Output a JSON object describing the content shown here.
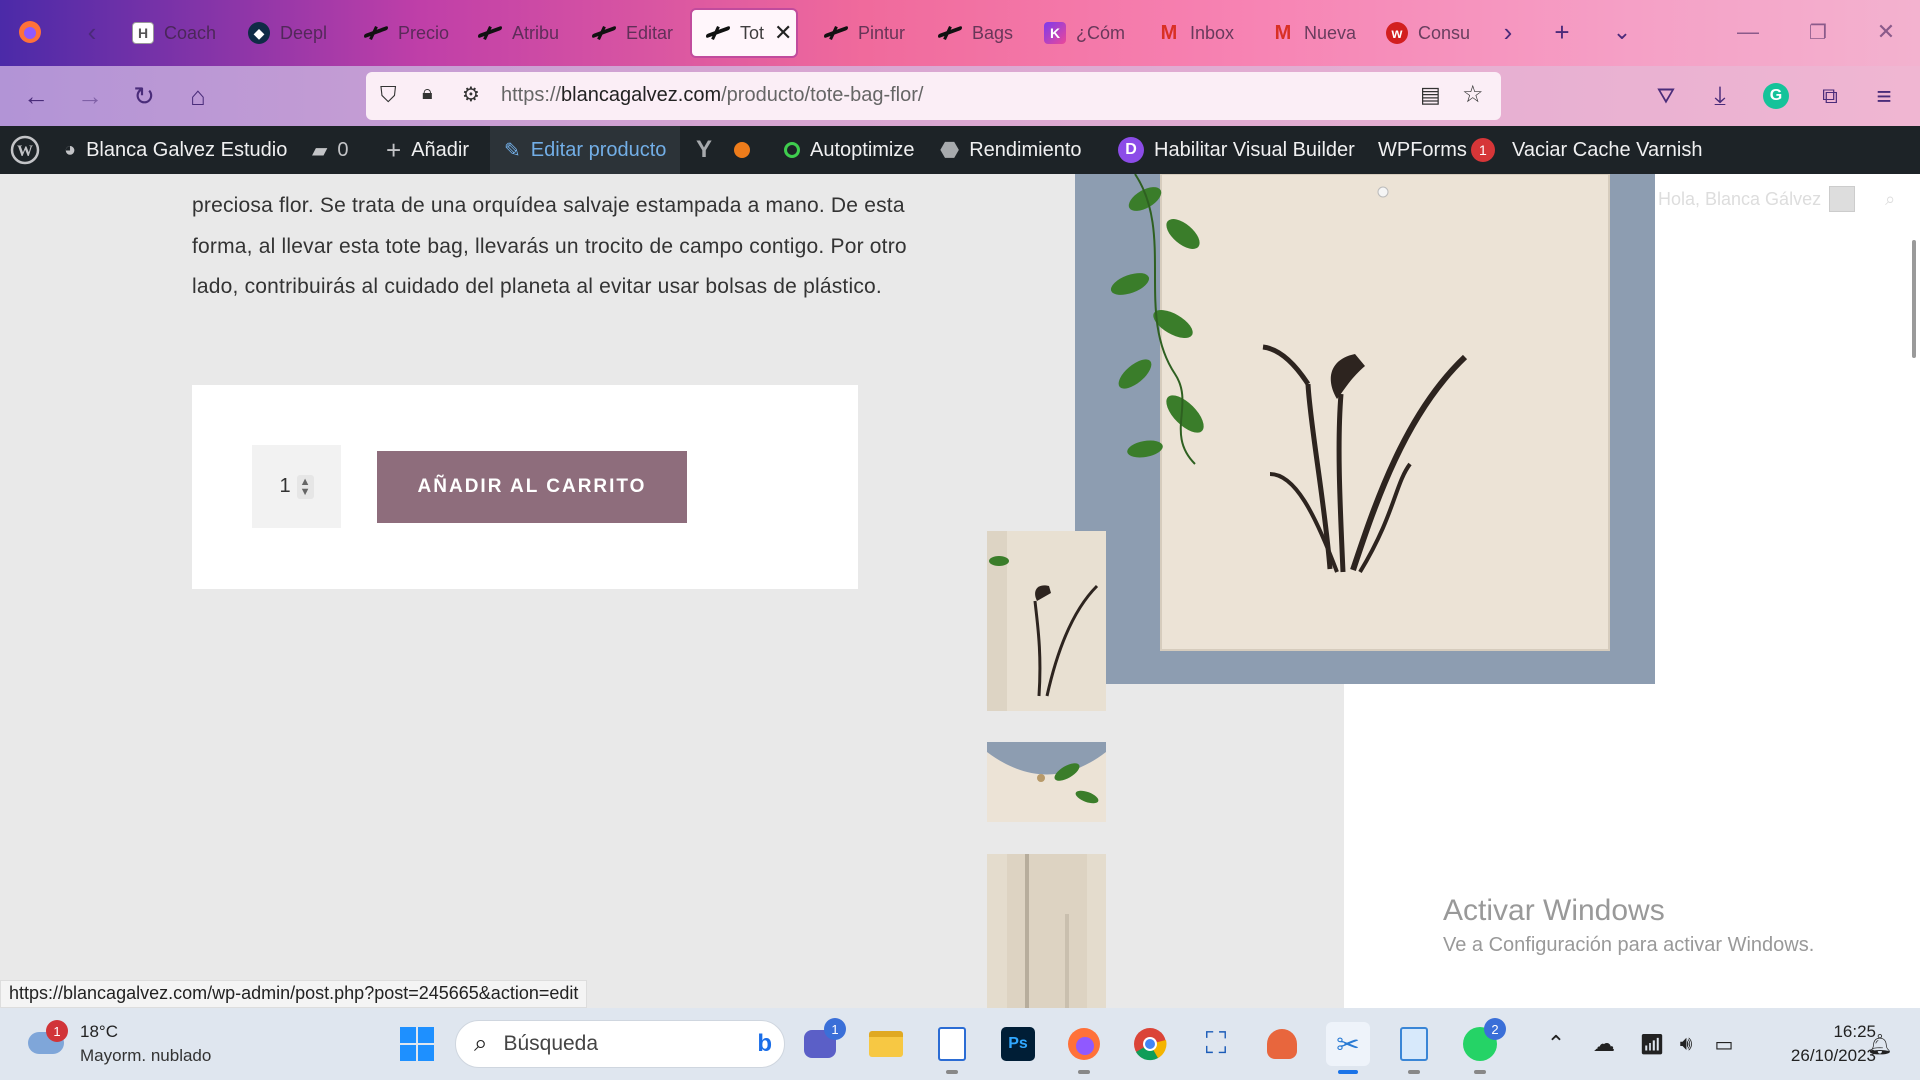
{
  "browser": {
    "tabs": [
      {
        "label": "Coach",
        "icon": "hq-icon"
      },
      {
        "label": "Deepl",
        "icon": "deepl-icon"
      },
      {
        "label": "Precio",
        "icon": "bird-icon"
      },
      {
        "label": "Atribu",
        "icon": "bird-icon"
      },
      {
        "label": "Editar",
        "icon": "bird-icon"
      },
      {
        "label": "Tot",
        "icon": "bird-icon",
        "active": true
      },
      {
        "label": "Pintur",
        "icon": "bird-icon"
      },
      {
        "label": "Bags",
        "icon": "bird-icon"
      },
      {
        "label": "¿Cóm",
        "icon": "k-icon"
      },
      {
        "label": "Inbox",
        "icon": "gmail-icon"
      },
      {
        "label": "Nueva",
        "icon": "gmail-icon"
      },
      {
        "label": "Consu",
        "icon": "w-icon"
      }
    ],
    "url_prefix": "https://",
    "url_domain": "blancagalvez.com",
    "url_path": "/producto/tote-bag-flor/"
  },
  "adminbar": {
    "site_name": "Blanca Galvez Estudio",
    "comments_count": "0",
    "add_label": "Añadir",
    "edit_label": "Editar producto",
    "autoptimize_label": "Autoptimize",
    "rendimiento_label": "Rendimiento",
    "visual_builder_label": "Habilitar Visual Builder",
    "wpforms_label": "WPForms",
    "wpforms_badge": "1",
    "varnish_label": "Vaciar Cache Varnish",
    "divi_letter": "D"
  },
  "product": {
    "description": "preciosa flor. Se trata de una orquídea salvaje estampada a mano. De esta forma, al llevar esta tote bag, llevarás un trocito de campo contigo. Por otro lado, contribuirás al cuidado del planeta al evitar usar bolsas de plástico.",
    "quantity": "1",
    "add_to_cart": "AÑADIR AL CARRITO",
    "greeting": "Hola, Blanca Gálvez"
  },
  "windows_watermark": {
    "title": "Activar Windows",
    "subtitle": "Ve a Configuración para activar Windows."
  },
  "status_url": "https://blancagalvez.com/wp-admin/post.php?post=245665&action=edit",
  "taskbar": {
    "weather_temp": "18°C",
    "weather_desc": "Mayorm. nublado",
    "weather_badge": "1",
    "search_placeholder": "Búsqueda",
    "teams_badge": "1",
    "whatsapp_badge": "2",
    "time": "16:25",
    "date": "26/10/2023"
  },
  "colors": {
    "accent_button": "#8e6d7c",
    "adminbar_bg": "#1d2327",
    "adminbar_highlight": "#72aee6",
    "badge_red": "#d63638"
  }
}
